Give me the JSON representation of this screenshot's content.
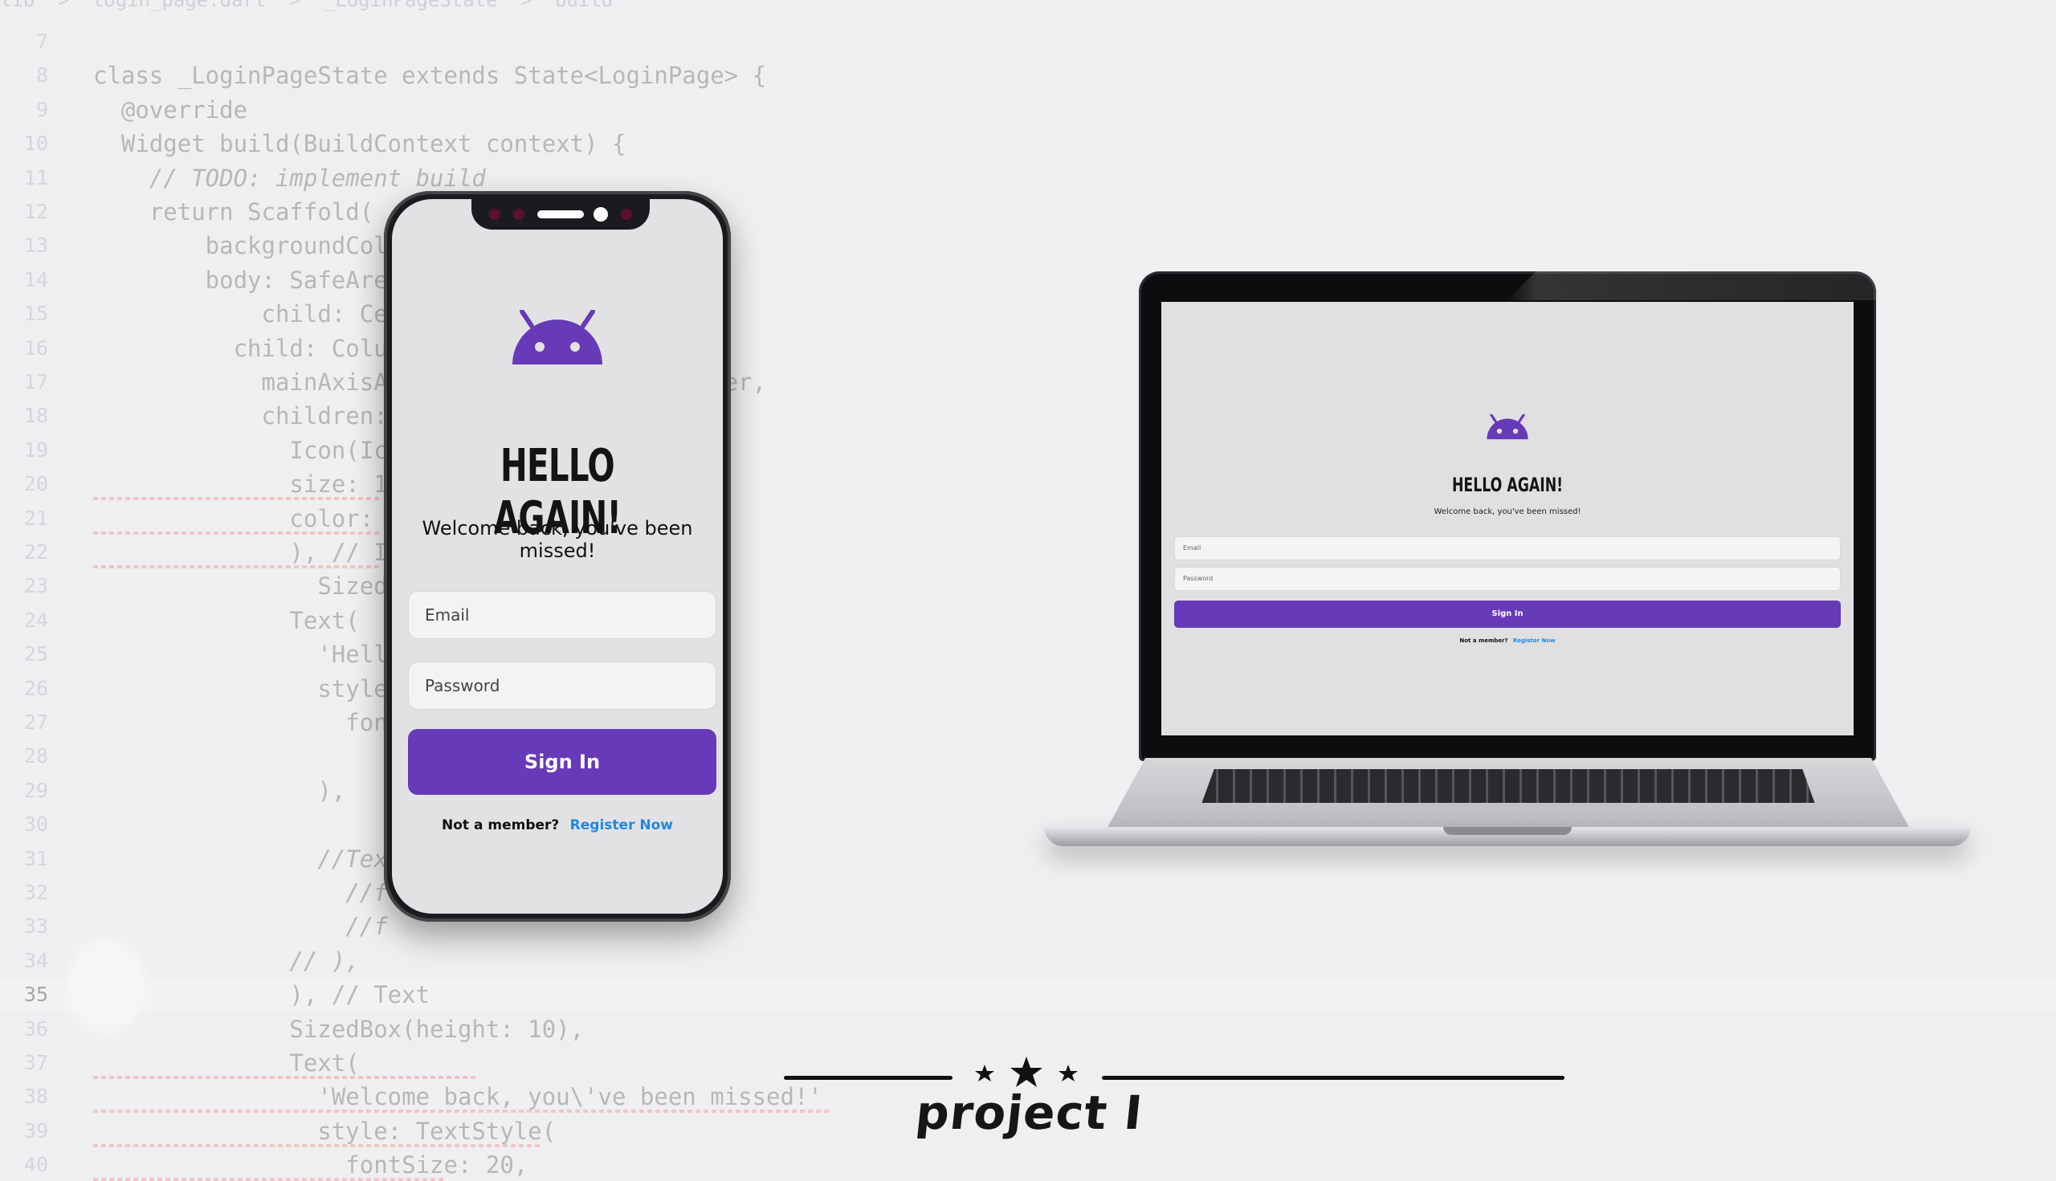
{
  "editor": {
    "breadcrumb": [
      "lib",
      ">",
      "login_page.dart",
      ">",
      "_LoginPageState",
      ">",
      "build"
    ],
    "lines": [
      {
        "n": "7",
        "code": ""
      },
      {
        "n": "8",
        "code": "class _LoginPageState extends State<LoginPage> {"
      },
      {
        "n": "9",
        "code": "  @override"
      },
      {
        "n": "10",
        "code": "  Widget build(BuildContext context) {"
      },
      {
        "n": "11",
        "code": "    // TODO: implement build"
      },
      {
        "n": "12",
        "code": "    return Scaffold("
      },
      {
        "n": "13",
        "code": "        backgroundCol"
      },
      {
        "n": "14",
        "code": "        body: SafeAre"
      },
      {
        "n": "15",
        "code": "            child: Ce"
      },
      {
        "n": "16",
        "code": "          child: Colu"
      },
      {
        "n": "17",
        "code": "            mainAxisA                  t.center,"
      },
      {
        "n": "18",
        "code": "            children:"
      },
      {
        "n": "19",
        "code": "              Icon(Ic"
      },
      {
        "n": "20",
        "code": "              size: 1"
      },
      {
        "n": "21",
        "code": "              color:"
      },
      {
        "n": "22",
        "code": "              ), // I"
      },
      {
        "n": "23",
        "code": "                Sized"
      },
      {
        "n": "24",
        "code": "              Text("
      },
      {
        "n": "25",
        "code": "                'Hell"
      },
      {
        "n": "26",
        "code": "                style"
      },
      {
        "n": "27",
        "code": "                  fon"
      },
      {
        "n": "28",
        "code": ""
      },
      {
        "n": "29",
        "code": "                ),"
      },
      {
        "n": "30",
        "code": ""
      },
      {
        "n": "31",
        "code": "                //Tex"
      },
      {
        "n": "32",
        "code": "                  //f"
      },
      {
        "n": "33",
        "code": "                  //f"
      },
      {
        "n": "34",
        "code": "              // ),"
      },
      {
        "n": "35",
        "code": "              ), // Text"
      },
      {
        "n": "36",
        "code": "              SizedBox(height: 10),"
      },
      {
        "n": "37",
        "code": "              Text("
      },
      {
        "n": "38",
        "code": "                'Welcome back, you\\'ve been missed!'"
      },
      {
        "n": "39",
        "code": "                style: TextStyle("
      },
      {
        "n": "40",
        "code": "                  fontSize: 20,"
      }
    ]
  },
  "phone_app": {
    "title": "HELLO AGAIN!",
    "subtitle": "Welcome back, you've been missed!",
    "email_placeholder": "Email",
    "password_placeholder": "Password",
    "sign_in_label": "Sign In",
    "footer_question": "Not a member?",
    "register_label": "Register Now"
  },
  "laptop_app": {
    "title": "HELLO AGAIN!",
    "subtitle": "Welcome back, you've been missed!",
    "email_placeholder": "Email",
    "password_placeholder": "Password",
    "sign_in_label": "Sign In",
    "footer_question": "Not a member?",
    "register_label": "Register Now"
  },
  "footer": {
    "title": "project I"
  },
  "colors": {
    "accent": "#673ab7",
    "link": "#1e88e5",
    "screen_bg": "#e0e0e2",
    "page_bg": "#efeff1"
  },
  "icons": [
    "android-logo-icon",
    "star-icon"
  ]
}
